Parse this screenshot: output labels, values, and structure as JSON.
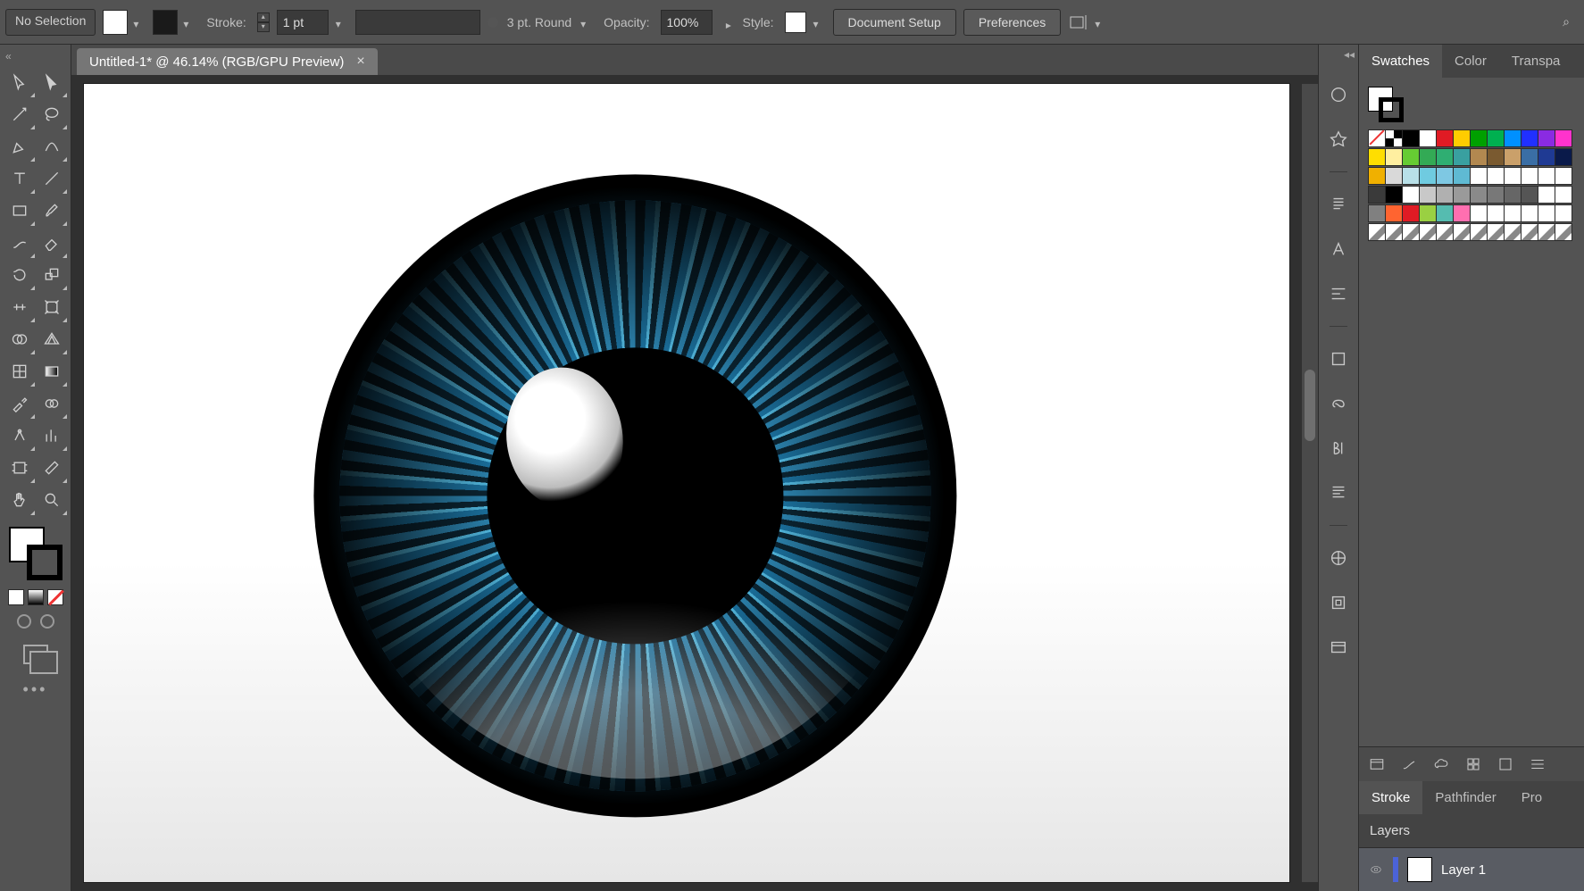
{
  "control_bar": {
    "selection_state": "No Selection",
    "stroke_label": "Stroke:",
    "stroke_weight": "1 pt",
    "profile_label": "3 pt. Round",
    "opacity_label": "Opacity:",
    "opacity_value": "100%",
    "style_label": "Style:",
    "doc_setup_btn": "Document Setup",
    "prefs_btn": "Preferences"
  },
  "doc_tab": {
    "title": "Untitled-1* @ 46.14% (RGB/GPU Preview)"
  },
  "tools": [
    "selection",
    "direct-selection",
    "magic-wand",
    "lasso",
    "pen",
    "curvature",
    "type",
    "line-segment",
    "rectangle",
    "paintbrush",
    "shaper",
    "eraser",
    "rotate",
    "scale",
    "width",
    "free-transform",
    "shape-builder",
    "perspective-grid",
    "mesh",
    "gradient",
    "eyedropper",
    "blend",
    "symbol-sprayer",
    "column-graph",
    "artboard",
    "slice",
    "hand",
    "zoom"
  ],
  "dock_icons": [
    "appearance",
    "graphic-styles",
    "paragraph",
    "character",
    "align",
    "transform",
    "symbols",
    "glyphs",
    "paragraph-styles",
    "color-guide",
    "asset-export",
    "libraries"
  ],
  "panels": {
    "tabs_top": [
      "Swatches",
      "Color",
      "Transpa"
    ],
    "tabs_mid": [
      "Stroke",
      "Pathfinder",
      "Pro"
    ],
    "layers_label": "Layers",
    "layer1_name": "Layer 1"
  },
  "swatch_colors_rows": [
    [
      "#ffffff",
      "#ffffff",
      "#000000",
      "#ffffff",
      "#e01b24",
      "#ffcc00",
      "#00a000",
      "#00b050",
      "#0090ff",
      "#2030ff",
      "#8a2be2",
      "#ff33cc"
    ],
    [
      "#ffde00",
      "#ffefa0",
      "#66cc33",
      "#33aa55",
      "#2fae72",
      "#39a0a0",
      "#b28850",
      "#7a5a30",
      "#caa06a",
      "#3a6ea5",
      "#1f3a93",
      "#0a1a4a"
    ],
    [
      "#f0b000",
      "#d9d9d9",
      "#b8e0e8",
      "#6fcbe0",
      "#7ec8e3",
      "#5fbad3",
      "#ffffff",
      "#ffffff",
      "#ffffff",
      "#ffffff",
      "#ffffff",
      "#ffffff"
    ],
    [
      "#3a3a3a",
      "#000000",
      "#ffffff",
      "#c8c8c8",
      "#b0b0b0",
      "#9a9a9a",
      "#8a8a8a",
      "#787878",
      "#666666",
      "#555555",
      "#ffffff",
      "#ffffff"
    ],
    [
      "#808080",
      "#ff6430",
      "#e01b24",
      "#9ad042",
      "#55bcb0",
      "#ff6fb0",
      "#ffffff",
      "#ffffff",
      "#ffffff",
      "#ffffff",
      "#ffffff",
      "#ffffff"
    ],
    [
      "#ffffff",
      "#ffffff",
      "#ffffff",
      "#ffffff",
      "#ffffff",
      "#ffffff",
      "#ffffff",
      "#ffffff",
      "#ffffff",
      "#ffffff",
      "#ffffff",
      "#ffffff"
    ]
  ]
}
